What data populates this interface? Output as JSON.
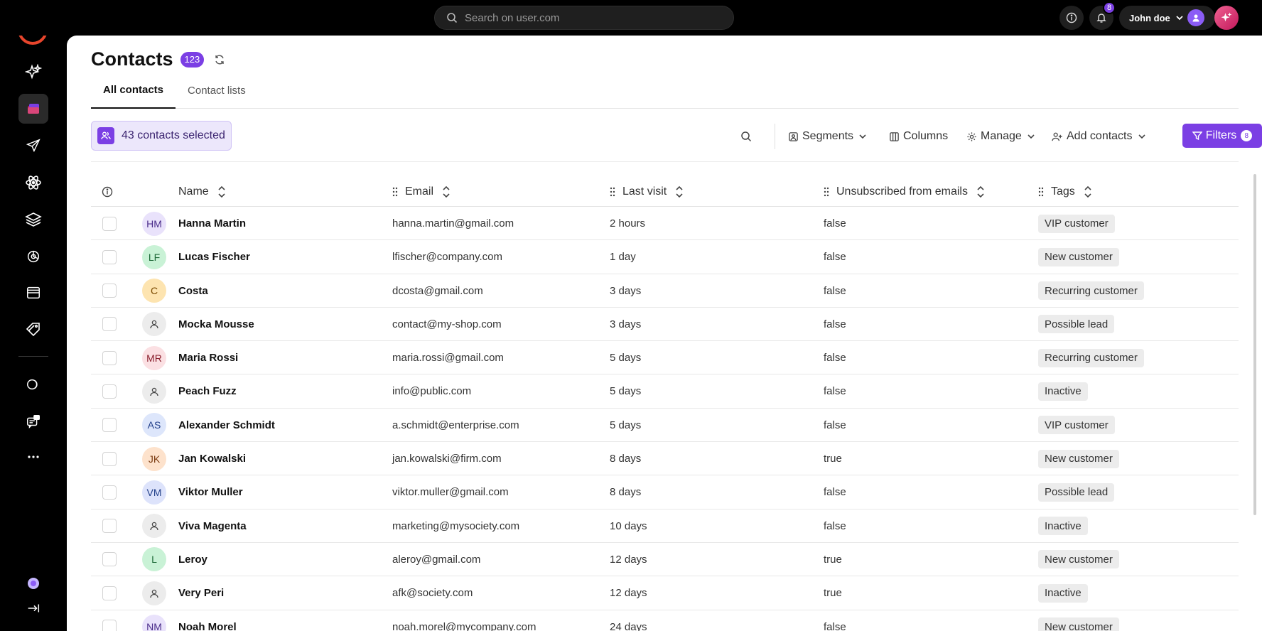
{
  "topbar": {
    "search_placeholder": "Search on user.com",
    "notifications_count": "8",
    "user_name": "John doe"
  },
  "sidebar": {
    "items": [
      {
        "icon": "sparkles-icon",
        "label": "AI"
      },
      {
        "icon": "contacts-icon",
        "label": "Contacts",
        "active": true
      },
      {
        "icon": "send-icon",
        "label": "Campaigns"
      },
      {
        "icon": "automation-icon",
        "label": "Automations"
      },
      {
        "icon": "layers-icon",
        "label": "Content"
      },
      {
        "icon": "chart-icon",
        "label": "Analytics"
      },
      {
        "icon": "browser-icon",
        "label": "Pages"
      },
      {
        "icon": "tags-icon",
        "label": "Deals"
      },
      {
        "icon": "chat-icon",
        "label": "Conversations"
      },
      {
        "icon": "messages-icon",
        "label": "Messages"
      },
      {
        "icon": "more-icon",
        "label": "More"
      }
    ]
  },
  "page": {
    "title": "Contacts",
    "count": "123"
  },
  "tabs": [
    {
      "label": "All contacts",
      "active": true
    },
    {
      "label": "Contact lists",
      "active": false
    }
  ],
  "toolbar": {
    "selected_label": "43 contacts selected",
    "segments_label": "Segments",
    "columns_label": "Columns",
    "manage_label": "Manage",
    "add_contacts_label": "Add contacts",
    "filters_label": "Filters",
    "filters_count": "8"
  },
  "table": {
    "columns": [
      "Name",
      "Email",
      "Last visit",
      "Unsubscribed from emails",
      "Tags"
    ],
    "rows": [
      {
        "initials": "HM",
        "avatar_bg": "#e9e2fb",
        "avatar_fg": "#4a2c8a",
        "name": "Hanna Martin",
        "email": "hanna.martin@gmail.com",
        "last_visit": "2 hours",
        "unsubscribed": "false",
        "tag": "VIP customer"
      },
      {
        "initials": "LF",
        "avatar_bg": "#c9f2d6",
        "avatar_fg": "#1f6b39",
        "name": "Lucas Fischer",
        "email": "lfischer@company.com",
        "last_visit": "1 day",
        "unsubscribed": "false",
        "tag": "New customer"
      },
      {
        "initials": "C",
        "avatar_bg": "#fde4b0",
        "avatar_fg": "#7a4a00",
        "name": "Costa",
        "email": "dcosta@gmail.com",
        "last_visit": "3 days",
        "unsubscribed": "false",
        "tag": "Recurring customer"
      },
      {
        "initials": "",
        "avatar_bg": "#ececec",
        "avatar_fg": "#555555",
        "name": "Mocka Mousse",
        "email": "contact@my-shop.com",
        "last_visit": "3 days",
        "unsubscribed": "false",
        "tag": "Possible lead"
      },
      {
        "initials": "MR",
        "avatar_bg": "#fbe0e3",
        "avatar_fg": "#8a1f2d",
        "name": "Maria Rossi",
        "email": "maria.rossi@gmail.com",
        "last_visit": "5 days",
        "unsubscribed": "false",
        "tag": "Recurring customer"
      },
      {
        "initials": "",
        "avatar_bg": "#ececec",
        "avatar_fg": "#555555",
        "name": "Peach Fuzz",
        "email": "info@public.com",
        "last_visit": "5 days",
        "unsubscribed": "false",
        "tag": "Inactive"
      },
      {
        "initials": "AS",
        "avatar_bg": "#dde6fb",
        "avatar_fg": "#23408a",
        "name": "Alexander Schmidt",
        "email": "a.schmidt@enterprise.com",
        "last_visit": "5 days",
        "unsubscribed": "false",
        "tag": "VIP customer"
      },
      {
        "initials": "JK",
        "avatar_bg": "#fde2cc",
        "avatar_fg": "#7a3a10",
        "name": "Jan Kowalski",
        "email": "jan.kowalski@firm.com",
        "last_visit": "8 days",
        "unsubscribed": "true",
        "tag": "New customer"
      },
      {
        "initials": "VM",
        "avatar_bg": "#dde3fb",
        "avatar_fg": "#23408a",
        "name": "Viktor Muller",
        "email": "viktor.muller@gmail.com",
        "last_visit": "8 days",
        "unsubscribed": "false",
        "tag": "Possible lead"
      },
      {
        "initials": "",
        "avatar_bg": "#ececec",
        "avatar_fg": "#555555",
        "name": "Viva Magenta",
        "email": "marketing@mysociety.com",
        "last_visit": "10 days",
        "unsubscribed": "false",
        "tag": "Inactive"
      },
      {
        "initials": "L",
        "avatar_bg": "#c9f2d6",
        "avatar_fg": "#1f6b39",
        "name": "Leroy",
        "email": "aleroy@gmail.com",
        "last_visit": "12 days",
        "unsubscribed": "true",
        "tag": "New customer"
      },
      {
        "initials": "",
        "avatar_bg": "#ececec",
        "avatar_fg": "#555555",
        "name": "Very Peri",
        "email": "afk@society.com",
        "last_visit": "12 days",
        "unsubscribed": "true",
        "tag": "Inactive"
      },
      {
        "initials": "NM",
        "avatar_bg": "#e9e2fb",
        "avatar_fg": "#4a2c8a",
        "name": "Noah Morel",
        "email": "noah.morel@mycompany.com",
        "last_visit": "24 days",
        "unsubscribed": "false",
        "tag": "New customer"
      }
    ]
  },
  "colors": {
    "accent": "#7b3fe4",
    "brand": "#e8452c"
  }
}
